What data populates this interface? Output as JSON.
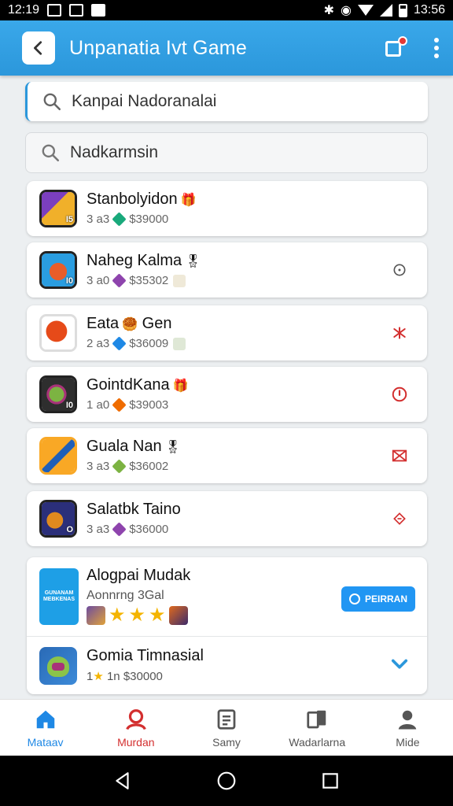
{
  "status_bar": {
    "time_left": "12:19",
    "time_right": "13:56"
  },
  "app_bar": {
    "title": "Unpanatia Ivt Game"
  },
  "search_primary": {
    "value": "Kanpai Nadoranalai"
  },
  "search_secondary": {
    "value": "Nadkarmsin"
  },
  "games": [
    {
      "title": "Stanbolyidon",
      "emoji": "🎁",
      "rank": "3 a3",
      "price": "$39000",
      "thumb_num": "I5",
      "colors": [
        "#7b3fbf",
        "#f0b02a"
      ],
      "gem_color": "#19a97b",
      "action": "none"
    },
    {
      "title": "Naheg Kalma",
      "emoji": "🎖",
      "rank": "3 a0",
      "price": "$35302",
      "thumb_num": "I0",
      "colors": [
        "#2a9de0",
        "#e85d2a"
      ],
      "gem_color": "#8e44ad",
      "action": "info"
    },
    {
      "title": "Eata",
      "emoji": "🥮",
      "title2": "Gen",
      "rank": "2 a3",
      "price": "$36009",
      "thumb_num": "",
      "colors": [
        "#ffffff",
        "#e64a19"
      ],
      "gem_color": "#1e88e5",
      "action": "pin"
    },
    {
      "title": "GointdKana",
      "emoji": "🎁",
      "rank": "1 a0",
      "price": "$39003",
      "thumb_num": "I0",
      "colors": [
        "#2e2e2e",
        "#7cb342"
      ],
      "gem_color": "#ef6c00",
      "action": "clock"
    },
    {
      "title": "Guala Nan",
      "emoji": "🎖",
      "rank": "3 a3",
      "price": "$36002",
      "thumb_num": "",
      "colors": [
        "#f9a825",
        "#1e5fb8"
      ],
      "gem_color": "#7cb342",
      "action": "mail"
    },
    {
      "title": "Salatbk Taino",
      "emoji": "",
      "rank": "3 a3",
      "price": "$36000",
      "thumb_num": "O",
      "colors": [
        "#2b2f7a",
        "#e08a1e"
      ],
      "gem_color": "#8e44ad",
      "action": "dash"
    }
  ],
  "featured": {
    "title": "Alogpai Mudak",
    "subtitle": "Aonnrng 3Gal",
    "thumb_text": "GUNANAM MEBKENAS",
    "button_label": "PEIRRAN",
    "stars": [
      "★",
      "★",
      "★"
    ]
  },
  "featured_row": {
    "title": "Gomia Timnasial",
    "rank_num": "1",
    "star": "★",
    "rank_text": "1n",
    "price": "$30000"
  },
  "bottom_nav": [
    {
      "label": "Mataav",
      "icon": "home-icon"
    },
    {
      "label": "Murdan",
      "icon": "person-icon"
    },
    {
      "label": "Samy",
      "icon": "document-icon"
    },
    {
      "label": "Wadarlarna",
      "icon": "cards-icon"
    },
    {
      "label": "Mide",
      "icon": "profile-icon"
    }
  ]
}
